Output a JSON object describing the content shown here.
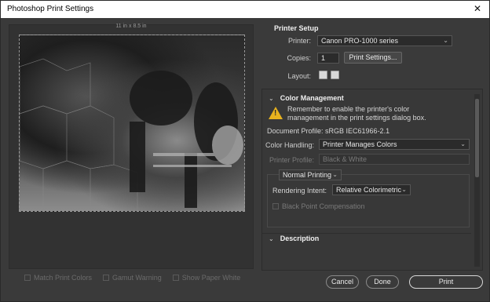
{
  "window": {
    "title": "Photoshop Print Settings",
    "close_glyph": "✕"
  },
  "preview": {
    "size_label": "11 in x 8.5 in",
    "checkboxes": [
      {
        "label": "Match Print Colors"
      },
      {
        "label": "Gamut Warning"
      },
      {
        "label": "Show Paper White"
      }
    ]
  },
  "printer_setup": {
    "title": "Printer Setup",
    "printer_label": "Printer:",
    "printer_value": "Canon PRO-1000 series",
    "copies_label": "Copies:",
    "copies_value": "1",
    "print_settings_button": "Print Settings...",
    "layout_label": "Layout:"
  },
  "color_management": {
    "title": "Color Management",
    "warning_text": "Remember to enable the printer's color management in the print settings dialog box.",
    "document_profile": "Document Profile: sRGB IEC61966-2.1",
    "color_handling_label": "Color Handling:",
    "color_handling_value": "Printer Manages Colors",
    "printer_profile_label": "Printer Profile:",
    "printer_profile_value": "Black & White",
    "printing_mode_value": "Normal Printing",
    "rendering_intent_label": "Rendering Intent:",
    "rendering_intent_value": "Relative Colorimetric",
    "black_point_label": "Black Point Compensation"
  },
  "description": {
    "title": "Description"
  },
  "footer": {
    "cancel": "Cancel",
    "done": "Done",
    "print": "Print"
  },
  "icons": {
    "chevron": "⌄",
    "section_chevron": "⌄"
  }
}
